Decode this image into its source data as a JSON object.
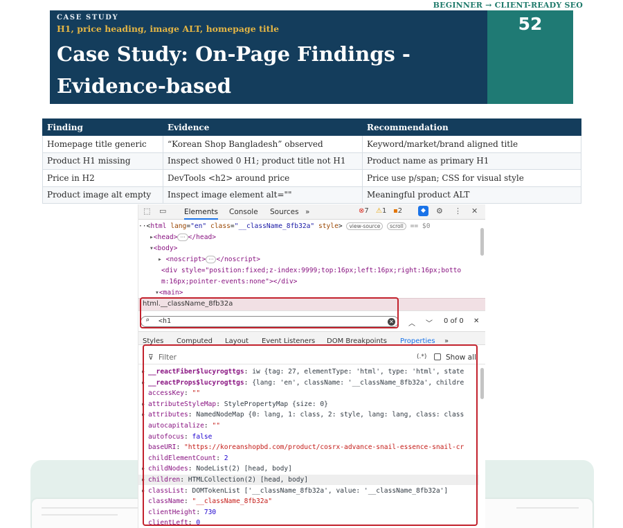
{
  "brand": "BEGINNER → CLIENT-READY SEO",
  "header": {
    "kicker": "CASE STUDY",
    "subtitle": "H1, price heading, image ALT, homepage title",
    "title": "Case Study: On-Page Findings - Evidence-based",
    "page_number": "52"
  },
  "table": {
    "headers": [
      "Finding",
      "Evidence",
      "Recommendation"
    ],
    "rows": [
      [
        "Homepage title generic",
        "“Korean Shop Bangladesh” observed",
        "Keyword/market/brand aligned title"
      ],
      [
        "Product H1 missing",
        "Inspect showed 0 H1; product title not H1",
        "Product name as primary H1"
      ],
      [
        "Price in H2",
        "DevTools <h2> around price",
        "Price use p/span; CSS for visual style"
      ],
      [
        "Product image alt empty",
        "Inspect image element alt=\"\"",
        "Meaningful product ALT"
      ]
    ]
  },
  "devtools": {
    "tabs": {
      "elements": "Elements",
      "console": "Console",
      "sources": "Sources"
    },
    "counts": {
      "errors": "7",
      "warnings": "1",
      "info": "2"
    },
    "tree": {
      "html_open": "html",
      "lang_attr": "lang",
      "lang_val": "\"en\"",
      "class_attr": "class",
      "class_val": "\"__className_8fb32a\"",
      "style_attr": "style",
      "view_source": "view-source",
      "scroll": "scroll",
      "dollar": "== $0",
      "head": "<head>",
      "head_close": "</head>",
      "body": "<body>",
      "noscript": "<noscript>",
      "noscript_close": "</noscript>",
      "div_open": "<div style=\"position:fixed;z-index:9999;top:16px;left:16px;right:16px;botto",
      "div_cont": "m:16px;pointer-events:none\"></div>",
      "main": "<main>"
    },
    "breadcrumb": "html.__className_8fb32a",
    "search": {
      "query": "<h1",
      "result": "0 of 0"
    },
    "panel_tabs": [
      "Styles",
      "Computed",
      "Layout",
      "Event Listeners",
      "DOM Breakpoints",
      "Properties"
    ],
    "filter": {
      "placeholder": "Filter",
      "regex": "(.*)",
      "show_all": "Show all"
    },
    "properties": [
      {
        "key": "__reactFiber$lucyrogttgs",
        "val": "iw {tag: 27, elementType: 'html', type: 'html', state",
        "expand": true,
        "bold": true
      },
      {
        "key": "__reactProps$lucyrogttgs",
        "val": "{lang: 'en', className: '__className_8fb32a', childre",
        "expand": true,
        "bold": true
      },
      {
        "key": "accessKey",
        "val": "\"\"",
        "expand": false
      },
      {
        "key": "attributeStyleMap",
        "val": "StylePropertyMap {size: 0}",
        "expand": true
      },
      {
        "key": "attributes",
        "val": "NamedNodeMap {0: lang, 1: class, 2: style, lang: lang, class: class",
        "expand": true
      },
      {
        "key": "autocapitalize",
        "val": "\"\"",
        "expand": false
      },
      {
        "key": "autofocus",
        "val": "false",
        "expand": false
      },
      {
        "key": "baseURI",
        "val": "\"https://koreanshopbd.com/product/cosrx-advance-snail-essence-snail-cr",
        "expand": false
      },
      {
        "key": "childElementCount",
        "val": "2",
        "expand": false
      },
      {
        "key": "childNodes",
        "val": "NodeList(2) [head, body]",
        "expand": true
      },
      {
        "key": "children",
        "val": "HTMLCollection(2) [head, body]",
        "expand": true
      },
      {
        "key": "classList",
        "val": "DOMTokenList ['__className_8fb32a', value: '__className_8fb32a']",
        "expand": true
      },
      {
        "key": "className",
        "val": "\"__className_8fb32a\"",
        "expand": false
      },
      {
        "key": "clientHeight",
        "val": "730",
        "expand": false
      },
      {
        "key": "clientLeft",
        "val": "0",
        "expand": false
      }
    ]
  },
  "colors": {
    "navy": "#143d5c",
    "teal": "#1f7a74",
    "gold": "#e3b545",
    "highlight": "#c2212c"
  }
}
